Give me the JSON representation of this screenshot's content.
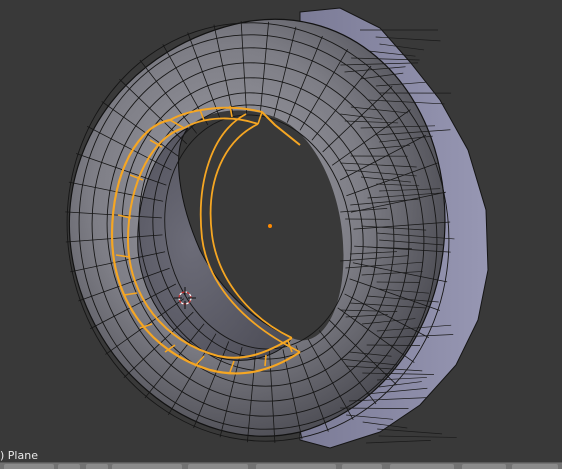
{
  "viewport": {
    "object_info": ") Plane"
  },
  "colors": {
    "background": "#393939",
    "mesh_face": "#7f7f86",
    "mesh_wire": "#101010",
    "selected_edge": "#f5a623",
    "origin_point": "#ff8a00",
    "tread_face": "#8c8ca6"
  },
  "icons": {
    "cursor": "3d-cursor-icon",
    "origin": "object-origin-icon"
  }
}
